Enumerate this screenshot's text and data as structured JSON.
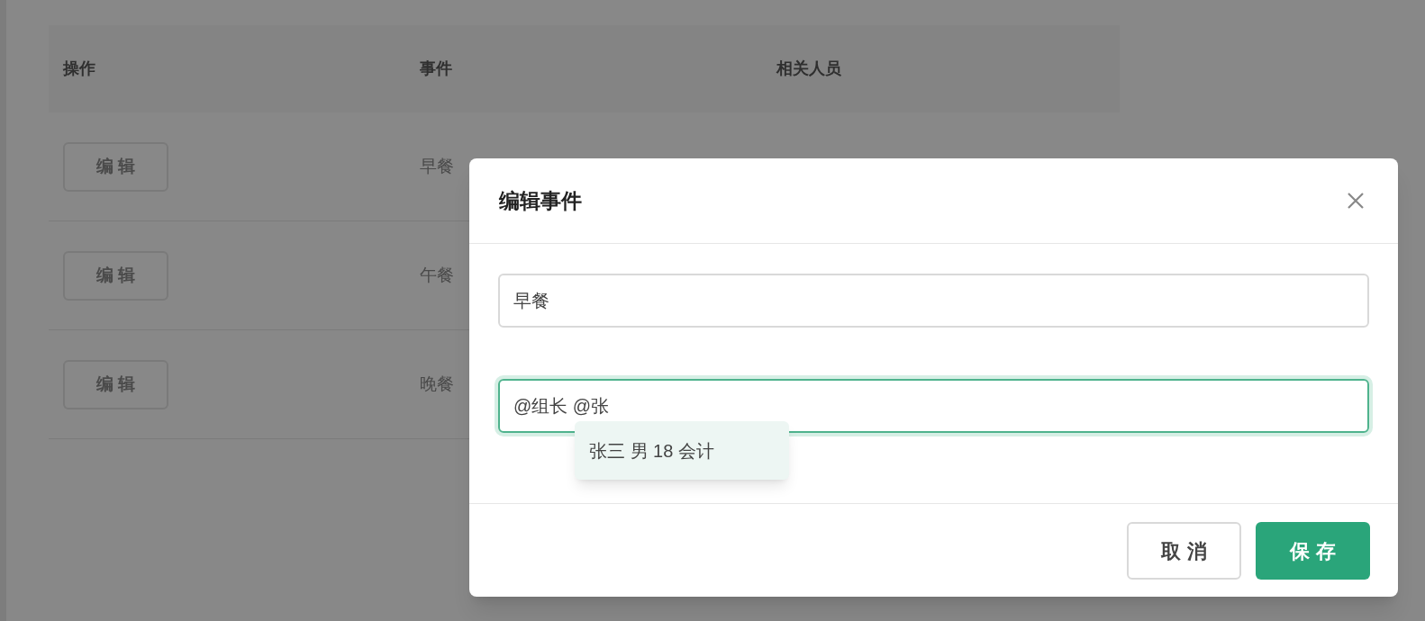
{
  "table": {
    "columns": [
      "操作",
      "事件",
      "相关人员"
    ],
    "rows": [
      {
        "action": "编 辑",
        "event": "早餐"
      },
      {
        "action": "编 辑",
        "event": "午餐"
      },
      {
        "action": "编 辑",
        "event": "晚餐"
      }
    ]
  },
  "dialog": {
    "title": "编辑事件",
    "fields": [
      {
        "value": "早餐",
        "focused": false
      },
      {
        "value": "@组长 @张",
        "focused": true
      }
    ],
    "suggestions": [
      {
        "label": "张三 男 18 会计",
        "selected": true
      }
    ],
    "buttons": [
      {
        "label": "取 消",
        "kind": "secondary"
      },
      {
        "label": "保 存",
        "kind": "primary"
      }
    ]
  }
}
